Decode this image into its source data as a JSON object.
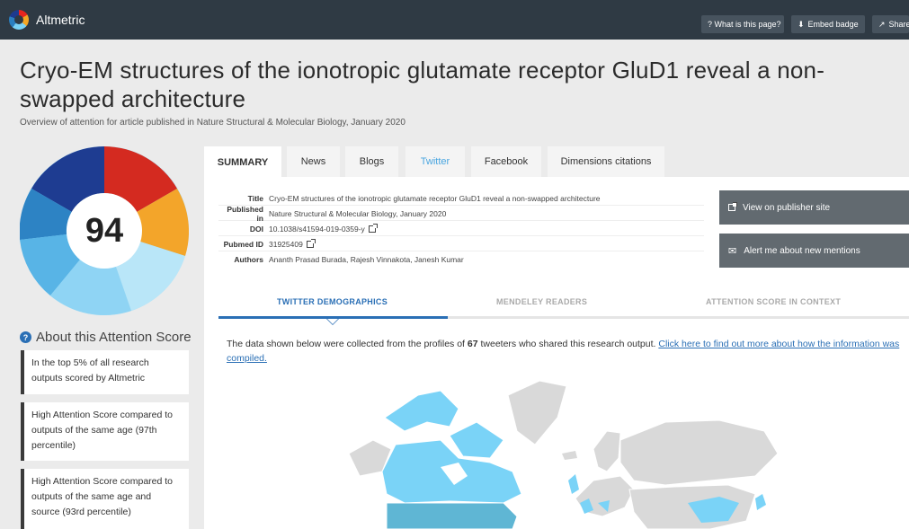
{
  "topbar": {
    "brand": "Altmetric",
    "what_is_this_page": "? What is this page?",
    "embed_badge": "Embed badge",
    "share": "Share"
  },
  "header": {
    "title": "Cryo-EM structures of the ionotropic glutamate receptor GluD1 reveal a non-swapped architecture",
    "subtitle": "Overview of attention for article published in Nature Structural & Molecular Biology, January 2020"
  },
  "score": {
    "value": "94"
  },
  "about": {
    "heading": "About this Attention Score",
    "cards": [
      "In the top 5% of all research outputs scored by Altmetric",
      "High Attention Score compared to outputs of the same age (97th percentile)",
      "High Attention Score compared to outputs of the same age and source (93rd percentile)"
    ]
  },
  "tabs": [
    "SUMMARY",
    "News",
    "Blogs",
    "Twitter",
    "Facebook",
    "Dimensions citations"
  ],
  "details": {
    "title_label": "Title",
    "title_value": "Cryo-EM structures of the ionotropic glutamate receptor GluD1 reveal a non-swapped architecture",
    "published_label": "Published in",
    "published_value": "Nature Structural & Molecular Biology, January 2020",
    "doi_label": "DOI",
    "doi_value": "10.1038/s41594-019-0359-y",
    "pubmed_label": "Pubmed ID",
    "pubmed_value": "31925409",
    "authors_label": "Authors",
    "authors_value": "Ananth Prasad Burada, Rajesh Vinnakota, Janesh Kumar"
  },
  "actions": {
    "view_publisher": "View on publisher site",
    "alert_me": "Alert me about new mentions"
  },
  "subtabs": [
    "TWITTER DEMOGRAPHICS",
    "MENDELEY READERS",
    "ATTENTION SCORE IN CONTEXT"
  ],
  "demographics": {
    "text_before": "The data shown below were collected from the profiles of ",
    "count": "67",
    "text_after": " tweeters who shared this research output. ",
    "link": "Click here to find out more about how the information was compiled."
  },
  "colors": {
    "topbar": "#2f3a44",
    "accent_blue": "#2a6fb5",
    "map_highlight": "#7ad3f7",
    "map_land": "#d9d9d9"
  }
}
